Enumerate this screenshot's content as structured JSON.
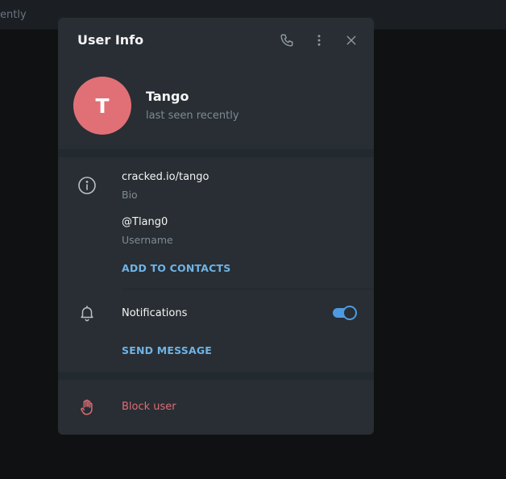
{
  "background": {
    "status_fragment": "ently"
  },
  "modal": {
    "title": "User Info"
  },
  "header_actions": {
    "call_icon": "phone-icon",
    "more_icon": "more-vertical-icon",
    "close_icon": "close-icon"
  },
  "profile": {
    "avatar_letter": "T",
    "avatar_color": "#e17076",
    "name": "Tango",
    "status": "last seen recently"
  },
  "info": {
    "bio_value": "cracked.io/tango",
    "bio_label": "Bio",
    "username_value": "@Tlang0",
    "username_label": "Username",
    "add_contact_label": "ADD TO CONTACTS"
  },
  "notifications": {
    "label": "Notifications",
    "enabled": true,
    "send_message_label": "SEND MESSAGE"
  },
  "danger": {
    "block_label": "Block user"
  },
  "colors": {
    "accent": "#6fb3e6",
    "toggle": "#4e9ae0",
    "danger": "#e06c75",
    "panel": "#282e33"
  }
}
